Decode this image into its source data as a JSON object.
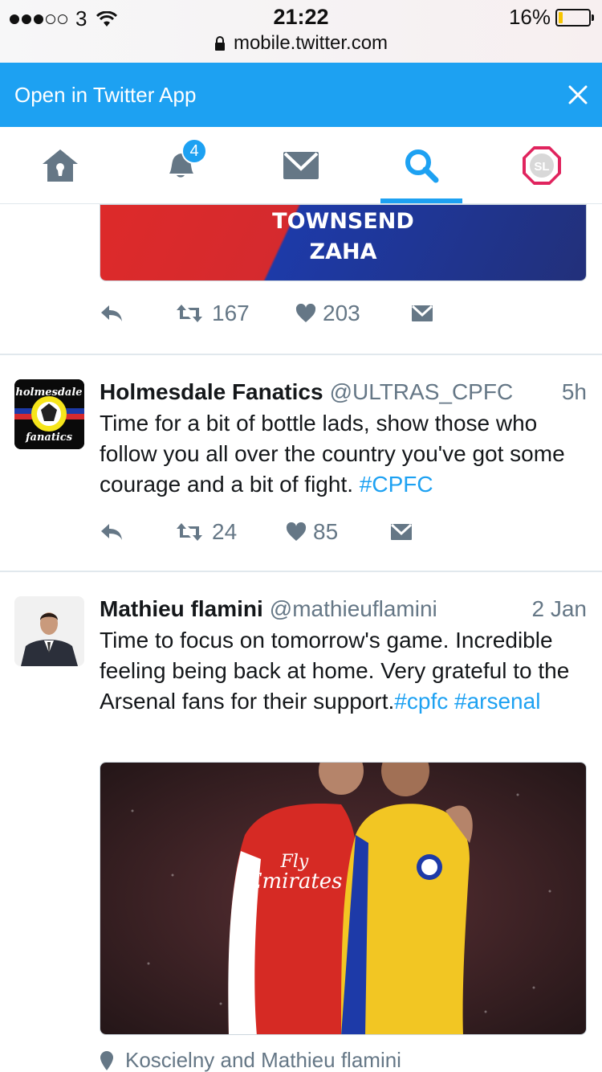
{
  "status_bar": {
    "carrier": "3",
    "time": "21:22",
    "battery": "16%",
    "battery_level": 0.16,
    "url": "mobile.twitter.com"
  },
  "banner": {
    "text": "Open in Twitter App"
  },
  "nav": {
    "notification_count": "4",
    "active_tab": "search",
    "tabs": [
      "home-icon",
      "bell-icon",
      "mail-icon",
      "search-icon",
      "profile-icon"
    ],
    "accent_color": "#1da1f2"
  },
  "tweet1": {
    "media_lines": [
      "TOWNSEND",
      "ZAHA"
    ],
    "retweets": "167",
    "likes": "203"
  },
  "tweet2": {
    "name": "Holmesdale Fanatics",
    "handle": "@ULTRAS_CPFC",
    "time": "5h",
    "avatar_text": "holmesdale fanatics",
    "text": "Time for a bit of bottle lads, show those who follow you all over the country you've got some courage and a bit of fight. ",
    "hashtag": "#CPFC",
    "retweets": "24",
    "likes": "85"
  },
  "tweet3": {
    "name": "Mathieu flamini",
    "handle": "@mathieuflamini",
    "time": "2 Jan",
    "text": "Time to focus on tomorrow's game. Incredible feeling being back at home. Very grateful to the Arsenal fans for their support.",
    "hashtag1": "#cpfc",
    "hashtag2": "#arsenal",
    "media_shirt_text": [
      "Fly",
      "Emirates"
    ],
    "location": "Koscielny and Mathieu flamini"
  }
}
